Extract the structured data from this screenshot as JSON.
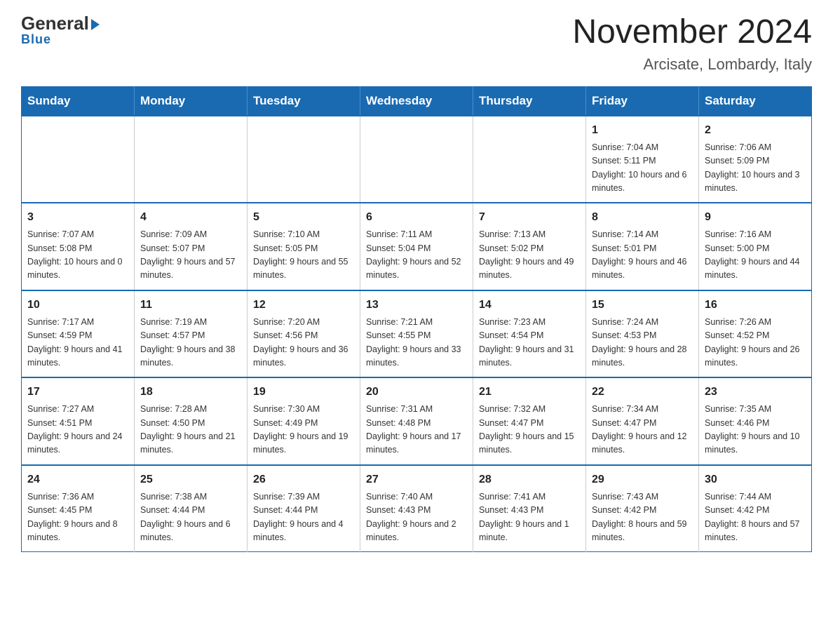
{
  "logo": {
    "general": "General",
    "arrow": "▶",
    "blue": "Blue"
  },
  "title": "November 2024",
  "subtitle": "Arcisate, Lombardy, Italy",
  "days_of_week": [
    "Sunday",
    "Monday",
    "Tuesday",
    "Wednesday",
    "Thursday",
    "Friday",
    "Saturday"
  ],
  "weeks": [
    [
      {
        "day": "",
        "info": ""
      },
      {
        "day": "",
        "info": ""
      },
      {
        "day": "",
        "info": ""
      },
      {
        "day": "",
        "info": ""
      },
      {
        "day": "",
        "info": ""
      },
      {
        "day": "1",
        "info": "Sunrise: 7:04 AM\nSunset: 5:11 PM\nDaylight: 10 hours and 6 minutes."
      },
      {
        "day": "2",
        "info": "Sunrise: 7:06 AM\nSunset: 5:09 PM\nDaylight: 10 hours and 3 minutes."
      }
    ],
    [
      {
        "day": "3",
        "info": "Sunrise: 7:07 AM\nSunset: 5:08 PM\nDaylight: 10 hours and 0 minutes."
      },
      {
        "day": "4",
        "info": "Sunrise: 7:09 AM\nSunset: 5:07 PM\nDaylight: 9 hours and 57 minutes."
      },
      {
        "day": "5",
        "info": "Sunrise: 7:10 AM\nSunset: 5:05 PM\nDaylight: 9 hours and 55 minutes."
      },
      {
        "day": "6",
        "info": "Sunrise: 7:11 AM\nSunset: 5:04 PM\nDaylight: 9 hours and 52 minutes."
      },
      {
        "day": "7",
        "info": "Sunrise: 7:13 AM\nSunset: 5:02 PM\nDaylight: 9 hours and 49 minutes."
      },
      {
        "day": "8",
        "info": "Sunrise: 7:14 AM\nSunset: 5:01 PM\nDaylight: 9 hours and 46 minutes."
      },
      {
        "day": "9",
        "info": "Sunrise: 7:16 AM\nSunset: 5:00 PM\nDaylight: 9 hours and 44 minutes."
      }
    ],
    [
      {
        "day": "10",
        "info": "Sunrise: 7:17 AM\nSunset: 4:59 PM\nDaylight: 9 hours and 41 minutes."
      },
      {
        "day": "11",
        "info": "Sunrise: 7:19 AM\nSunset: 4:57 PM\nDaylight: 9 hours and 38 minutes."
      },
      {
        "day": "12",
        "info": "Sunrise: 7:20 AM\nSunset: 4:56 PM\nDaylight: 9 hours and 36 minutes."
      },
      {
        "day": "13",
        "info": "Sunrise: 7:21 AM\nSunset: 4:55 PM\nDaylight: 9 hours and 33 minutes."
      },
      {
        "day": "14",
        "info": "Sunrise: 7:23 AM\nSunset: 4:54 PM\nDaylight: 9 hours and 31 minutes."
      },
      {
        "day": "15",
        "info": "Sunrise: 7:24 AM\nSunset: 4:53 PM\nDaylight: 9 hours and 28 minutes."
      },
      {
        "day": "16",
        "info": "Sunrise: 7:26 AM\nSunset: 4:52 PM\nDaylight: 9 hours and 26 minutes."
      }
    ],
    [
      {
        "day": "17",
        "info": "Sunrise: 7:27 AM\nSunset: 4:51 PM\nDaylight: 9 hours and 24 minutes."
      },
      {
        "day": "18",
        "info": "Sunrise: 7:28 AM\nSunset: 4:50 PM\nDaylight: 9 hours and 21 minutes."
      },
      {
        "day": "19",
        "info": "Sunrise: 7:30 AM\nSunset: 4:49 PM\nDaylight: 9 hours and 19 minutes."
      },
      {
        "day": "20",
        "info": "Sunrise: 7:31 AM\nSunset: 4:48 PM\nDaylight: 9 hours and 17 minutes."
      },
      {
        "day": "21",
        "info": "Sunrise: 7:32 AM\nSunset: 4:47 PM\nDaylight: 9 hours and 15 minutes."
      },
      {
        "day": "22",
        "info": "Sunrise: 7:34 AM\nSunset: 4:47 PM\nDaylight: 9 hours and 12 minutes."
      },
      {
        "day": "23",
        "info": "Sunrise: 7:35 AM\nSunset: 4:46 PM\nDaylight: 9 hours and 10 minutes."
      }
    ],
    [
      {
        "day": "24",
        "info": "Sunrise: 7:36 AM\nSunset: 4:45 PM\nDaylight: 9 hours and 8 minutes."
      },
      {
        "day": "25",
        "info": "Sunrise: 7:38 AM\nSunset: 4:44 PM\nDaylight: 9 hours and 6 minutes."
      },
      {
        "day": "26",
        "info": "Sunrise: 7:39 AM\nSunset: 4:44 PM\nDaylight: 9 hours and 4 minutes."
      },
      {
        "day": "27",
        "info": "Sunrise: 7:40 AM\nSunset: 4:43 PM\nDaylight: 9 hours and 2 minutes."
      },
      {
        "day": "28",
        "info": "Sunrise: 7:41 AM\nSunset: 4:43 PM\nDaylight: 9 hours and 1 minute."
      },
      {
        "day": "29",
        "info": "Sunrise: 7:43 AM\nSunset: 4:42 PM\nDaylight: 8 hours and 59 minutes."
      },
      {
        "day": "30",
        "info": "Sunrise: 7:44 AM\nSunset: 4:42 PM\nDaylight: 8 hours and 57 minutes."
      }
    ]
  ]
}
